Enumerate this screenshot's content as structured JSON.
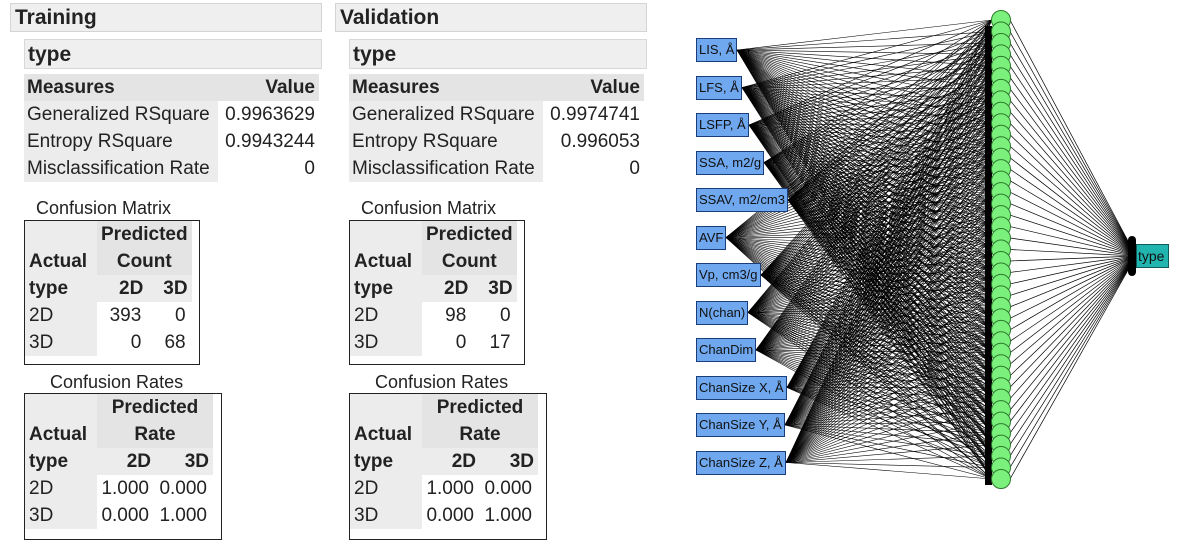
{
  "panels": [
    {
      "title": "Training",
      "response": "type",
      "measures": {
        "header": [
          "Measures",
          "Value"
        ],
        "rows": [
          {
            "label": "Generalized RSquare",
            "value": "0.9963629"
          },
          {
            "label": "Entropy RSquare",
            "value": "0.9943244"
          },
          {
            "label": "Misclassification Rate",
            "value": "0"
          }
        ]
      },
      "confusion_matrix": {
        "caption": "Confusion Matrix",
        "top_label": "Predicted",
        "stat_label": "Count",
        "actual_label": "Actual",
        "type_label": "type",
        "columns": [
          "2D",
          "3D"
        ],
        "rows": [
          {
            "label": "2D",
            "values": [
              "393",
              "0"
            ]
          },
          {
            "label": "3D",
            "values": [
              "0",
              "68"
            ]
          }
        ]
      },
      "confusion_rates": {
        "caption": "Confusion Rates",
        "top_label": "Predicted",
        "stat_label": "Rate",
        "actual_label": "Actual",
        "type_label": "type",
        "columns": [
          "2D",
          "3D"
        ],
        "rows": [
          {
            "label": "2D",
            "values": [
              "1.000",
              "0.000"
            ]
          },
          {
            "label": "3D",
            "values": [
              "0.000",
              "1.000"
            ]
          }
        ]
      }
    },
    {
      "title": "Validation",
      "response": "type",
      "measures": {
        "header": [
          "Measures",
          "Value"
        ],
        "rows": [
          {
            "label": "Generalized RSquare",
            "value": "0.9974741"
          },
          {
            "label": "Entropy RSquare",
            "value": "0.996053"
          },
          {
            "label": "Misclassification Rate",
            "value": "0"
          }
        ]
      },
      "confusion_matrix": {
        "caption": "Confusion Matrix",
        "top_label": "Predicted",
        "stat_label": "Count",
        "actual_label": "Actual",
        "type_label": "type",
        "columns": [
          "2D",
          "3D"
        ],
        "rows": [
          {
            "label": "2D",
            "values": [
              "98",
              "0"
            ]
          },
          {
            "label": "3D",
            "values": [
              "0",
              "17"
            ]
          }
        ]
      },
      "confusion_rates": {
        "caption": "Confusion Rates",
        "top_label": "Predicted",
        "stat_label": "Rate",
        "actual_label": "Actual",
        "type_label": "type",
        "columns": [
          "2D",
          "3D"
        ],
        "rows": [
          {
            "label": "2D",
            "values": [
              "1.000",
              "0.000"
            ]
          },
          {
            "label": "3D",
            "values": [
              "0.000",
              "1.000"
            ]
          }
        ]
      }
    }
  ],
  "network": {
    "inputs": [
      "LIS, Å",
      "LFS, Å",
      "LSFP, Å",
      "SSA, m2/g",
      "SSAV, m2/cm3",
      "AVF",
      "Vp, cm3/g",
      "N(chan)",
      "ChanDim",
      "ChanSize X, Å",
      "ChanSize Y, Å",
      "ChanSize Z, Å"
    ],
    "hidden_node_count": 41,
    "output": "type",
    "colors": {
      "input_fill": "#6fa8ef",
      "hidden_fill": "#7cf07c",
      "output_fill": "#22b5b0",
      "edge": "#000000"
    }
  }
}
